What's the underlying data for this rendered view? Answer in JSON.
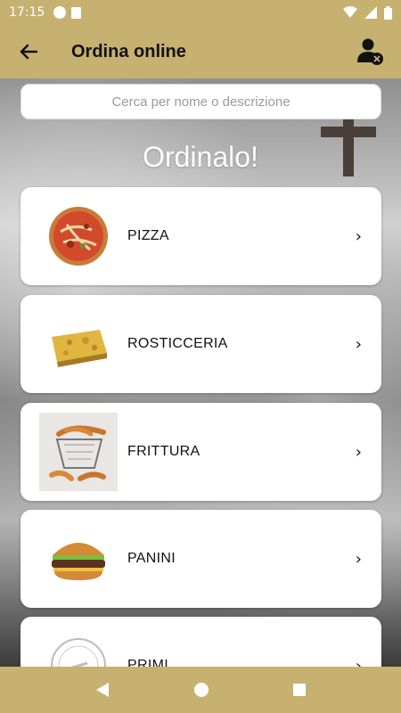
{
  "status": {
    "time": "17:15",
    "left_icons": [
      "notification-app-icon",
      "sd-card-icon"
    ],
    "right_icons": [
      "wifi-icon",
      "signal-icon",
      "battery-icon"
    ]
  },
  "app_bar": {
    "title": "Ordina online",
    "back_icon": "arrow-back-icon",
    "account_icon": "account-cancel-icon"
  },
  "search": {
    "placeholder": "Cerca per nome o descrizione"
  },
  "hero": {
    "title": "Ordinalo!"
  },
  "categories": [
    {
      "label": "PIZZA",
      "image": "pizza-image"
    },
    {
      "label": "ROSTICCERIA",
      "image": "rosticceria-image"
    },
    {
      "label": "FRITTURA",
      "image": "fries-basket-image"
    },
    {
      "label": "PANINI",
      "image": "burger-image"
    },
    {
      "label": "PRIMI",
      "image": "stamp-logo-image"
    }
  ],
  "chevron": "›",
  "colors": {
    "accent": "#c6b170",
    "card": "#ffffff",
    "text": "#111111"
  },
  "nav_bar": {
    "icons": [
      "back-triangle-icon",
      "home-circle-icon",
      "recents-square-icon"
    ]
  }
}
